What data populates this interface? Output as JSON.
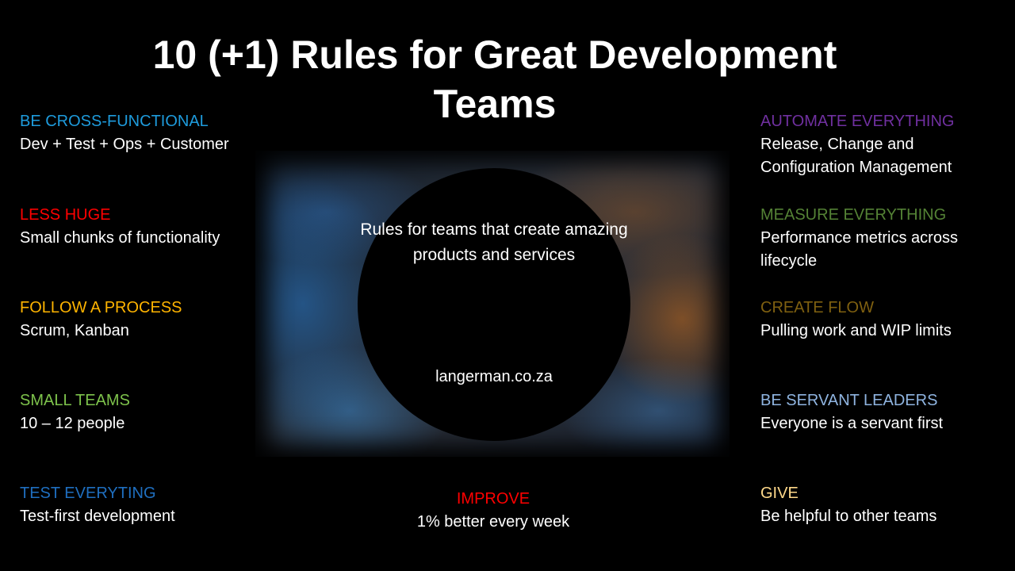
{
  "slide": {
    "title_line1": "10 (+1) Rules for Great Development",
    "title_line2": "Teams",
    "center": {
      "tagline": "Rules for teams that create amazing products and services",
      "website": "langerman.co.za"
    },
    "left_rules": [
      {
        "heading": "BE CROSS-FUNCTIONAL",
        "detail": "Dev + Test + Ops + Customer",
        "color": "#1E9BDC"
      },
      {
        "heading": "LESS HUGE",
        "detail": "Small chunks of functionality",
        "color": "#FF0000"
      },
      {
        "heading": "FOLLOW A PROCESS",
        "detail": "Scrum, Kanban",
        "color": "#FFB400"
      },
      {
        "heading": "SMALL TEAMS",
        "detail": "10 – 12 people",
        "color": "#7DC24B"
      },
      {
        "heading": "TEST EVERYTING",
        "detail": "Test-first development",
        "color": "#1F6FC0"
      }
    ],
    "right_rules": [
      {
        "heading": "AUTOMATE EVERYTHING",
        "detail": "Release, Change and Configuration Management",
        "color": "#7030A0"
      },
      {
        "heading": "MEASURE EVERYTHING",
        "detail": "Performance metrics across lifecycle",
        "color": "#548235"
      },
      {
        "heading": "CREATE FLOW",
        "detail": "Pulling work and WIP limits",
        "color": "#7F6010"
      },
      {
        "heading": "BE SERVANT LEADERS",
        "detail": "Everyone is a servant first",
        "color": "#8FB4E0"
      },
      {
        "heading": "GIVE",
        "detail": "Be helpful to other teams",
        "color": "#FFD98A"
      }
    ],
    "bottom_rule": {
      "heading": "IMPROVE",
      "detail": "1% better every week",
      "color": "#FF0000"
    }
  }
}
